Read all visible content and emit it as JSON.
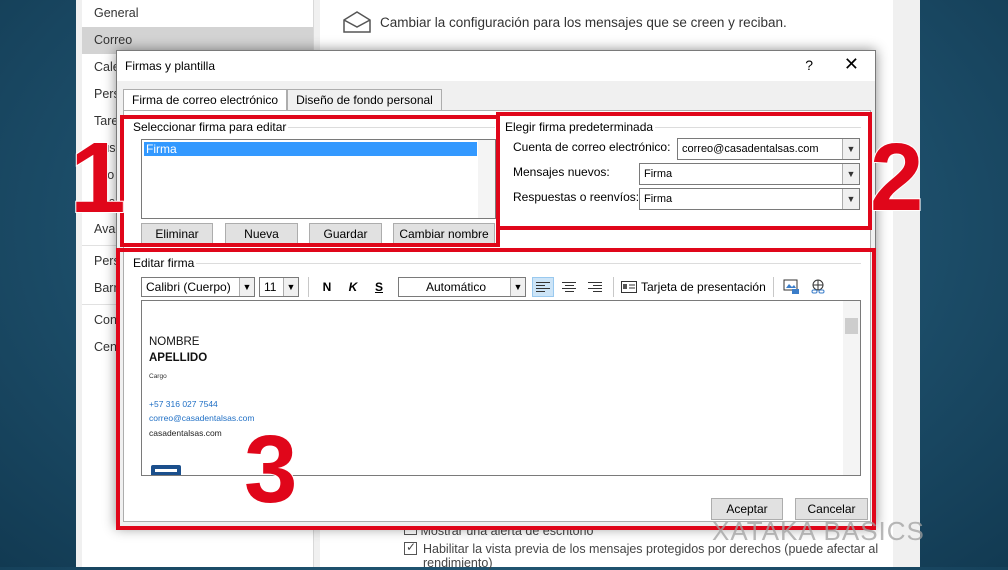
{
  "options": {
    "sidebar": [
      "General",
      "Correo",
      "Cale",
      "Pers",
      "Tare",
      "Búsq",
      "Idio",
      "Acc",
      "Avan",
      "Pers",
      "Barr",
      "Con",
      "Cent"
    ],
    "header": "Cambiar la configuración para los mensajes que se creen y reciban.",
    "bottom1": "Mostrar una alerta de escritorio",
    "bottom2": "Habilitar la vista previa de los mensajes protegidos por derechos (puede afectar al",
    "bottom3": "rendimiento)"
  },
  "dialog": {
    "title": "Firmas y plantilla",
    "help": "?",
    "close": "✕",
    "tabs": [
      "Firma de correo electrónico",
      "Diseño de fondo personal"
    ],
    "select_group": "Seleccionar firma para editar",
    "signatures": [
      "Firma"
    ],
    "buttons": [
      "Eliminar",
      "Nueva",
      "Guardar",
      "Cambiar nombre"
    ],
    "default_group": "Elegir firma predeterminada",
    "account_label": "Cuenta de correo electrónico:",
    "account_value": "correo@casadentalsas.com",
    "new_label": "Mensajes nuevos:",
    "new_value": "Firma",
    "reply_label": "Respuestas o reenvíos:",
    "reply_value": "Firma",
    "edit_group": "Editar firma",
    "font": "Calibri (Cuerpo)",
    "size": "11",
    "bold": "N",
    "italic": "K",
    "underline": "S",
    "color": "Automático",
    "business_card": "Tarjeta de presentación",
    "ok": "Aceptar",
    "cancel": "Cancelar"
  },
  "signature": {
    "name": "NOMBRE",
    "surname": "APELLIDO",
    "role": "Cargo",
    "phone": "+57 316 027 7544",
    "email": "correo@casadentalsas.com",
    "web": "casadentalsas.com"
  },
  "annotations": [
    "1",
    "2",
    "3"
  ],
  "watermark": "XATAKA BASICS",
  "colors": {
    "annotation": "#e0061a",
    "link": "#1f6fc5",
    "selection": "#3399ff"
  }
}
